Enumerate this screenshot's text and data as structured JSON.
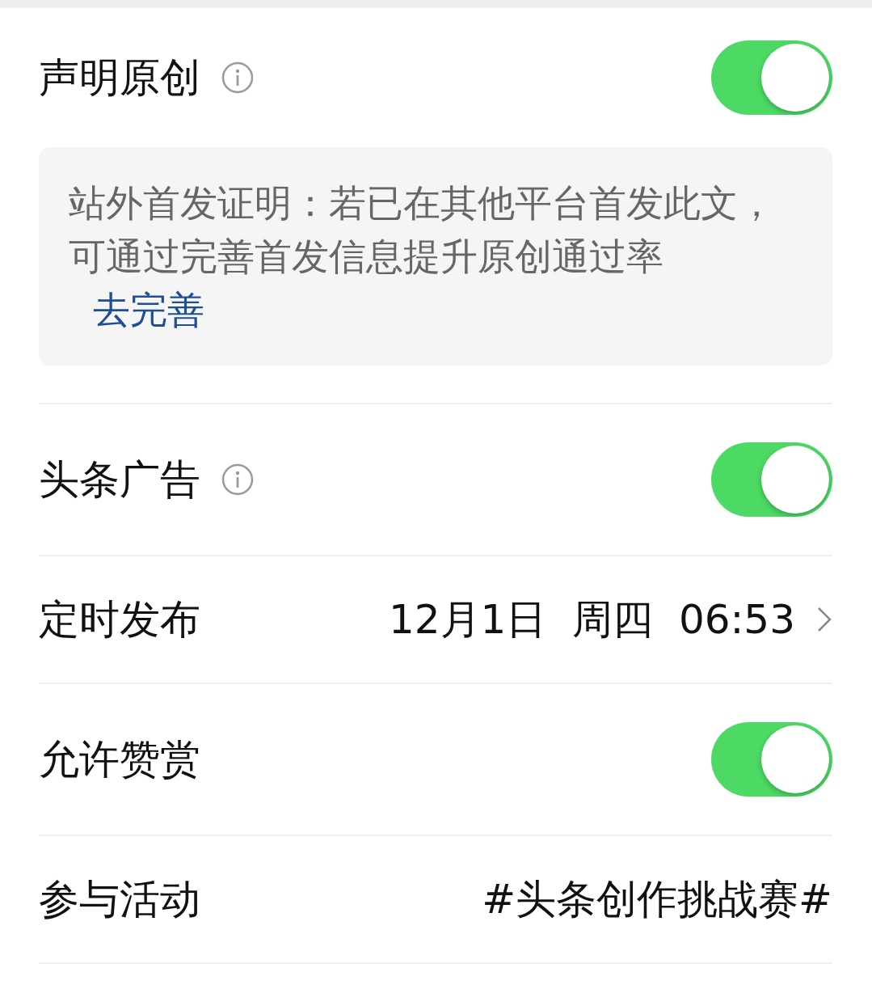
{
  "settings": [
    {
      "kind": "toggle",
      "label": "声明原创",
      "info": true,
      "on": true
    },
    {
      "kind": "notice",
      "text": "站外首发证明：若已在其他平台首发此文，可通过完善首发信息提升原创通过率",
      "link": "去完善"
    },
    {
      "kind": "toggle",
      "label": "头条广告",
      "info": true,
      "on": true
    },
    {
      "kind": "link",
      "label": "定时发布",
      "value": "12月1日  周四  06:53"
    },
    {
      "kind": "toggle",
      "label": "允许赞赏",
      "info": false,
      "on": true
    },
    {
      "kind": "value",
      "label": "参与活动",
      "value": "#头条创作挑战赛#"
    }
  ]
}
